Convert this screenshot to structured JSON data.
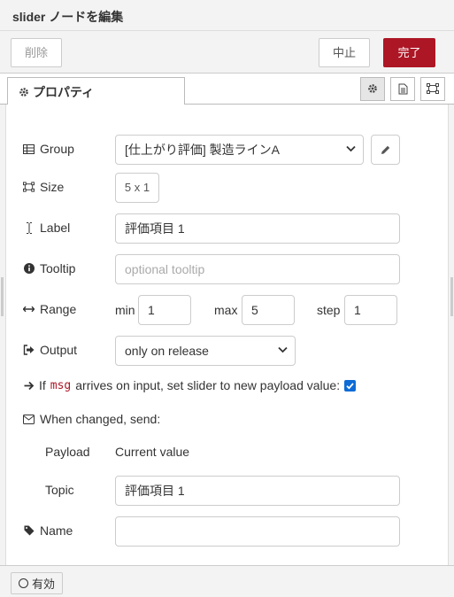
{
  "dialog": {
    "title": "slider ノードを編集"
  },
  "toolbar": {
    "delete_label": "削除",
    "cancel_label": "中止",
    "done_label": "完了"
  },
  "tabs": {
    "properties_label": "プロパティ"
  },
  "icons": {
    "settings": "gear-icon",
    "description": "document-icon",
    "appearance": "frame-icon",
    "group": "table-icon",
    "size": "resize-icon",
    "label": "text-cursor-icon",
    "tooltip": "info-icon",
    "range": "arrows-horizontal-icon",
    "output": "sign-out-icon",
    "if_msg": "arrow-right-icon",
    "when_changed": "envelope-icon",
    "name": "tag-icon"
  },
  "form": {
    "group_label": "Group",
    "group_value": "[仕上がり評価] 製造ラインA",
    "size_label": "Size",
    "size_value": "5 x 1",
    "label_label": "Label",
    "label_value": "評価項目 1",
    "tooltip_label": "Tooltip",
    "tooltip_placeholder": "optional tooltip",
    "range_label": "Range",
    "min_label": "min",
    "min_value": "1",
    "max_label": "max",
    "max_value": "5",
    "step_label": "step",
    "step_value": "1",
    "output_label": "Output",
    "output_value": "only on release",
    "if_msg_prefix": "If",
    "if_msg_code": "msg",
    "if_msg_suffix": "arrives on input, set slider to new payload value:",
    "if_msg_checked": true,
    "when_changed_label": "When changed, send:",
    "payload_label": "Payload",
    "payload_value": "Current value",
    "topic_label": "Topic",
    "topic_value": "評価項目 1",
    "name_label": "Name",
    "name_value": ""
  },
  "footer": {
    "enabled_label": "有効"
  },
  "colors": {
    "accent": "#ad1625",
    "checkbox": "#0e6bd6"
  }
}
